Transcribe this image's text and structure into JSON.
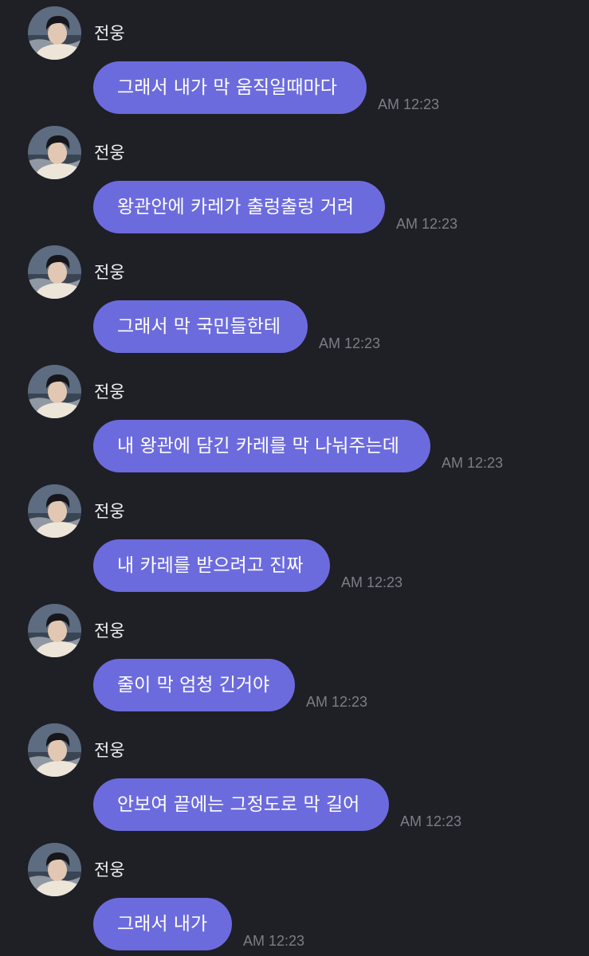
{
  "colors": {
    "background": "#1f1f26",
    "bubble": "#6c6bdd",
    "bubble_text": "#ffffff",
    "sender_text": "#f2f2f4",
    "timestamp_text": "#7d7d87"
  },
  "messages": [
    {
      "sender": "전웅",
      "text": "그래서 내가 막 움직일때마다",
      "time": "AM 12:23",
      "avatar": "profile-photo"
    },
    {
      "sender": "전웅",
      "text": "왕관안에 카레가 출렁출렁 거려",
      "time": "AM 12:23",
      "avatar": "profile-photo"
    },
    {
      "sender": "전웅",
      "text": "그래서 막 국민들한테",
      "time": "AM 12:23",
      "avatar": "profile-photo"
    },
    {
      "sender": "전웅",
      "text": "내 왕관에 담긴 카레를 막 나눠주는데",
      "time": "AM 12:23",
      "avatar": "profile-photo"
    },
    {
      "sender": "전웅",
      "text": "내 카레를 받으려고 진짜",
      "time": "AM 12:23",
      "avatar": "profile-photo"
    },
    {
      "sender": "전웅",
      "text": "줄이 막 엄청 긴거야",
      "time": "AM 12:23",
      "avatar": "profile-photo"
    },
    {
      "sender": "전웅",
      "text": "안보여 끝에는 그정도로 막 길어",
      "time": "AM 12:23",
      "avatar": "profile-photo"
    },
    {
      "sender": "전웅",
      "text": "그래서 내가",
      "time": "AM 12:23",
      "avatar": "profile-photo"
    }
  ]
}
